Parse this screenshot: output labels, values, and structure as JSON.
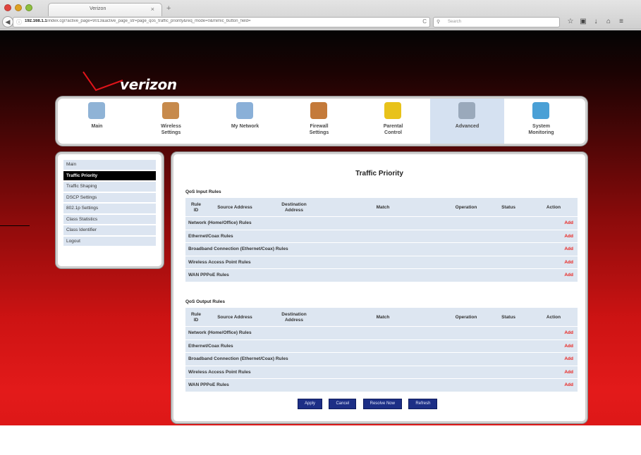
{
  "browser": {
    "tab_title": "Verizon",
    "tab_close": "×",
    "new_tab": "+",
    "url_host": "192.168.1.1",
    "url_path": "/index.cgi?active_page=9013&active_page_str=page_qos_traffic_priority&req_mode=0&mimic_button_field=",
    "reload": "C",
    "search_placeholder": "Search",
    "icons": [
      "star-icon",
      "clipboard-icon",
      "download-icon",
      "home-icon",
      "menu-icon"
    ]
  },
  "logo": {
    "text": "verizon"
  },
  "topnav": {
    "items": [
      {
        "label": "Main",
        "icon": "main-icon",
        "color": "#8fb3d6"
      },
      {
        "label": "Wireless\nSettings",
        "icon": "wireless-icon",
        "color": "#c78a4c"
      },
      {
        "label": "My Network",
        "icon": "network-icon",
        "color": "#8ab0d8"
      },
      {
        "label": "Firewall\nSettings",
        "icon": "firewall-icon",
        "color": "#c47a3a"
      },
      {
        "label": "Parental\nControl",
        "icon": "parental-icon",
        "color": "#e8c21a"
      },
      {
        "label": "Advanced",
        "icon": "advanced-icon",
        "color": "#9aa9bb"
      },
      {
        "label": "System\nMonitoring",
        "icon": "monitor-icon",
        "color": "#4aa0d6"
      }
    ],
    "active_index": 5
  },
  "sidebar": {
    "items": [
      {
        "label": "Main"
      },
      {
        "label": "Traffic Priority"
      },
      {
        "label": "Traffic Shaping"
      },
      {
        "label": "DSCP Settings"
      },
      {
        "label": "802.1p Settings"
      },
      {
        "label": "Class Statistics"
      },
      {
        "label": "Class Identifier"
      },
      {
        "label": "Logout"
      }
    ],
    "active_index": 1
  },
  "main": {
    "title": "Traffic Priority",
    "columns": [
      "Rule\nID",
      "Source Address",
      "Destination\nAddress",
      "Match",
      "Operation",
      "Status",
      "Action"
    ],
    "input_section": {
      "title": "QoS Input Rules",
      "rows": [
        {
          "label": "Network (Home/Office) Rules",
          "action": "Add"
        },
        {
          "label": "Ethernet/Coax Rules",
          "action": "Add"
        },
        {
          "label": "Broadband Connection (Ethernet/Coax) Rules",
          "action": "Add"
        },
        {
          "label": "Wireless Access Point Rules",
          "action": "Add"
        },
        {
          "label": "WAN PPPoE Rules",
          "action": "Add"
        }
      ]
    },
    "output_section": {
      "title": "QoS Output Rules",
      "rows": [
        {
          "label": "Network (Home/Office) Rules",
          "action": "Add"
        },
        {
          "label": "Ethernet/Coax Rules",
          "action": "Add"
        },
        {
          "label": "Broadband Connection (Ethernet/Coax) Rules",
          "action": "Add"
        },
        {
          "label": "Wireless Access Point Rules",
          "action": "Add"
        },
        {
          "label": "WAN PPPoE Rules",
          "action": "Add"
        }
      ]
    },
    "buttons": {
      "apply": "Apply",
      "cancel": "Cancel",
      "resolve": "Resolve Now",
      "refresh": "Refresh"
    }
  }
}
